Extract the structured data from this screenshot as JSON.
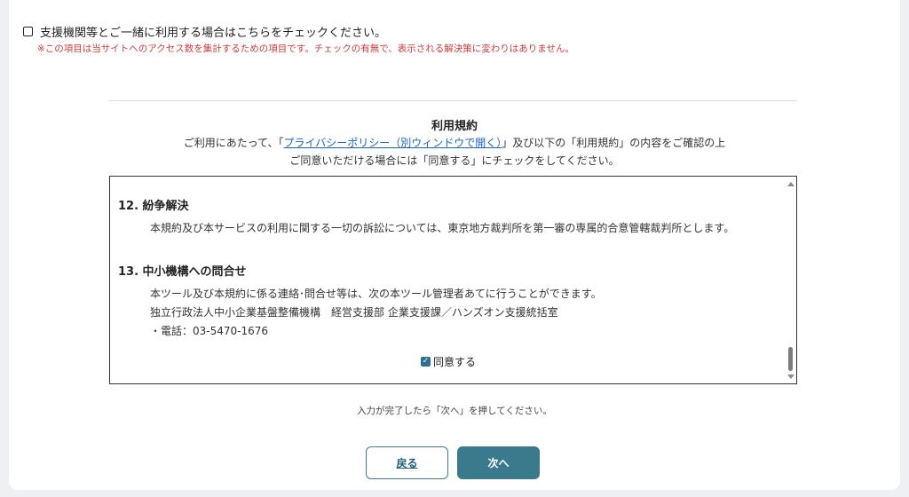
{
  "support": {
    "checkbox_label": "支援機関等とご一緒に利用する場合はこちらをチェックください。",
    "note": "※この項目は当サイトへのアクセス数を集計するための項目です。チェックの有無で、表示される解決策に変わりはありません。"
  },
  "terms": {
    "title": "利用規約",
    "intro_prefix": "ご利用にあたって、「",
    "privacy_link": "プライバシーポリシー（別ウィンドウで開く）",
    "intro_suffix": "」及び以下の「利用規約」の内容をご確認の上",
    "intro_line2": "ご同意いただける場合には「同意する」にチェックをしてください。",
    "sections": [
      {
        "heading": "12. 紛争解決",
        "body": "本規約及び本サービスの利用に関する一切の訴訟については、東京地方裁判所を第一審の専属的合意管轄裁判所とします。"
      },
      {
        "heading": "13. 中小機構への問合せ",
        "lines": [
          "本ツール及び本規約に係る連絡･問合せ等は、次の本ツール管理者あてに行うことができます。",
          "独立行政法人中小企業基盤整備機構　経営支援部 企業支援課／ハンズオン支援統括室",
          "・電話：03-5470-1676"
        ]
      }
    ],
    "agree_label": "同意する",
    "agree_checked": true
  },
  "footer": {
    "hint": "入力が完了したら「次へ」を押してください。",
    "back_label": "戻る",
    "next_label": "次へ"
  },
  "colors": {
    "accent": "#3b7a8c",
    "note_red": "#d23b3b",
    "link_blue": "#1b64c8"
  }
}
